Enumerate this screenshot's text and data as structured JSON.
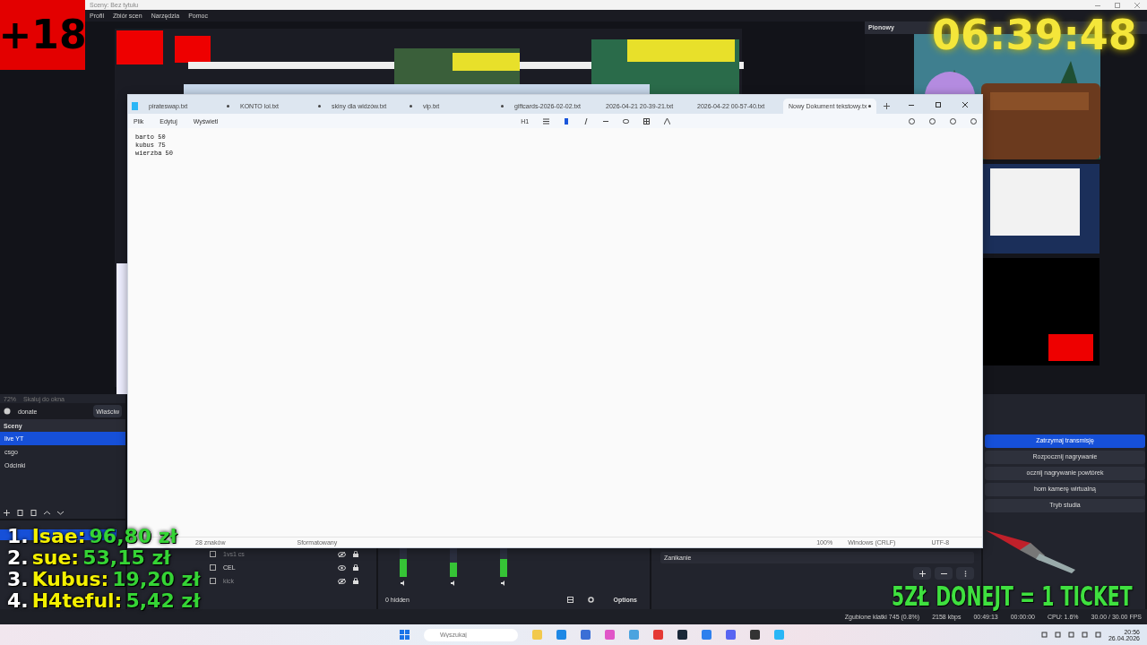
{
  "obs": {
    "title": "Sceny: Bez tytułu",
    "menu": [
      "Profil",
      "Zbiór scen",
      "Narzędzia",
      "Pomoc"
    ],
    "vertical_panel": {
      "title": "Pionowy"
    },
    "zoom_bar": {
      "zoom": "72%",
      "scale": "Skaluj do okna"
    },
    "source_bar": {
      "source": "donate",
      "properties": "Właściw"
    },
    "scenes": {
      "title": "Sceny",
      "items": [
        {
          "label": "live YT",
          "selected": true
        },
        {
          "label": "csgo",
          "selected": false
        },
        {
          "label": "Odcinki",
          "selected": false
        }
      ]
    },
    "sources": [
      {
        "label": "1vs1 cs",
        "visible": false
      },
      {
        "label": "CEL",
        "visible": true
      },
      {
        "label": "kick",
        "visible": false
      }
    ],
    "mixer": {
      "meters": [
        {
          "level": 0.55
        },
        {
          "level": 0.45
        },
        {
          "level": 0.55
        }
      ],
      "hidden": "0 hidden",
      "options": "Options"
    },
    "transition": "Zanikanie",
    "controls": [
      {
        "label": "Zatrzymaj transmisję",
        "active": true
      },
      {
        "label": "Rozpocznij nagrywanie",
        "active": false
      },
      {
        "label": "ocznij nagrywanie powtórek",
        "active": false
      },
      {
        "label": "hom kamerę wirtualną",
        "active": false
      },
      {
        "label": "Tryb studia",
        "active": false
      }
    ],
    "status": [
      "Zgubione klatki 745 (0.8%)",
      "2158 kbps",
      "00:49:13",
      "00:00:00",
      "CPU: 1.6%",
      "30.00 / 30.00 FPS"
    ]
  },
  "notepad": {
    "tabs": [
      {
        "label": "pirateswap.txt",
        "selected": false,
        "modified": true
      },
      {
        "label": "KONTO lol.txt",
        "selected": false,
        "modified": true
      },
      {
        "label": "skiny dla widzów.txt",
        "selected": false,
        "modified": true
      },
      {
        "label": "vip.txt",
        "selected": false,
        "modified": true
      },
      {
        "label": "giftcards-2026-02-02.txt",
        "selected": false,
        "modified": false
      },
      {
        "label": "2026-04-21 20-39-21.txt",
        "selected": false,
        "modified": false
      },
      {
        "label": "2026-04-22 00-57-40.txt",
        "selected": false,
        "modified": false
      },
      {
        "label": "Nowy Dokument tekstowy.tx",
        "selected": true,
        "modified": true
      }
    ],
    "menu": [
      "Plik",
      "Edytuj",
      "Wyświetl"
    ],
    "heading": "H1",
    "lines": [
      "barto 50",
      "kubus 75",
      "wierzba 50"
    ],
    "status": [
      "28 znaków",
      "Sformatowany",
      "100%",
      "Windows (CRLF)",
      "UTF-8"
    ]
  },
  "overlay": {
    "badge": "+18",
    "clock": "06:39:48",
    "leaderboard": [
      {
        "rank": "1.",
        "name": "Isae:",
        "amount": "96,80 zł"
      },
      {
        "rank": "2.",
        "name": "sue:",
        "amount": "53,15 zł"
      },
      {
        "rank": "3.",
        "name": "Kubus:",
        "amount": "19,20 zł"
      },
      {
        "rank": "4.",
        "name": "H4teful:",
        "amount": "5,42 zł"
      }
    ],
    "promo": "5ZŁ DONEJT = 1 TICKET"
  },
  "taskbar": {
    "search": {
      "placeholder": "Wyszukaj"
    },
    "time": "20:56",
    "date": "26.04.2026"
  }
}
